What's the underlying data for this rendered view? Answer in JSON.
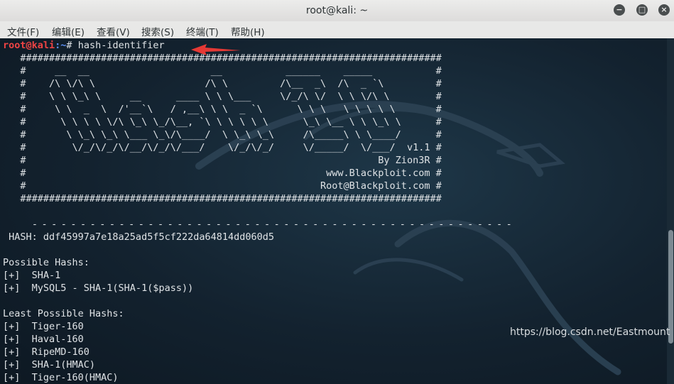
{
  "window": {
    "title": "root@kali: ~"
  },
  "window_controls": [
    "minimize",
    "maximize",
    "close"
  ],
  "menu": [
    "文件(F)",
    "编辑(E)",
    "查看(V)",
    "搜索(S)",
    "终端(T)",
    "帮助(H)"
  ],
  "prompt": {
    "user_host": "root@kali",
    "path": ":~",
    "symbol": "# ",
    "command": "hash-identifier"
  },
  "banner": [
    "   #########################################################################",
    "   #     __  __                     __           ______    _____           #",
    "   #    /\\ \\/\\ \\                   /\\ \\         /\\__  _\\  /\\  _ `\\         #",
    "   #    \\ \\ \\_\\ \\     __      ____ \\ \\ \\___     \\/_/\\ \\/  \\ \\ \\/\\ \\        #",
    "   #     \\ \\  _  \\  /'__`\\   / ,__\\ \\ \\  _ `\\      \\ \\ \\   \\ \\ \\ \\ \\       #",
    "   #      \\ \\ \\ \\ \\/\\ \\_\\ \\_/\\__, `\\ \\ \\ \\ \\ \\      \\_\\ \\__ \\ \\ \\_\\ \\      #",
    "   #       \\ \\_\\ \\_\\ \\___ \\_\\/\\____/  \\ \\_\\ \\_\\     /\\_____\\ \\ \\____/      #",
    "   #        \\/_/\\/_/\\/__/\\/_/\\/___/    \\/_/\\/_/     \\/_____/  \\/___/  v1.1 #",
    "   #                                                             By Zion3R #",
    "   #                                                    www.Blackploit.com #",
    "   #                                                   Root@Blackploit.com #",
    "   #########################################################################"
  ],
  "separator": "   --------------------------------------------------",
  "hash_line": " HASH: ddf45997a7e18a25ad5f5cf222da64814dd060d5",
  "possible": {
    "heading": "Possible Hashs:",
    "items": [
      "[+]  SHA-1",
      "[+]  MySQL5 - SHA-1(SHA-1($pass))"
    ]
  },
  "least": {
    "heading": "Least Possible Hashs:",
    "items": [
      "[+]  Tiger-160",
      "[+]  Haval-160",
      "[+]  RipeMD-160",
      "[+]  SHA-1(HMAC)",
      "[+]  Tiger-160(HMAC)"
    ]
  },
  "watermark": "https://blog.csdn.net/Eastmount",
  "colors": {
    "prompt_user": "#ef4444",
    "prompt_path": "#5c8ff2",
    "text": "#dfe3e6",
    "background": "#13222f",
    "arrow": "#e53935"
  },
  "icons": [
    "minimize-icon",
    "maximize-icon",
    "close-icon",
    "arrow-annotation-icon",
    "kali-dragon-icon"
  ]
}
